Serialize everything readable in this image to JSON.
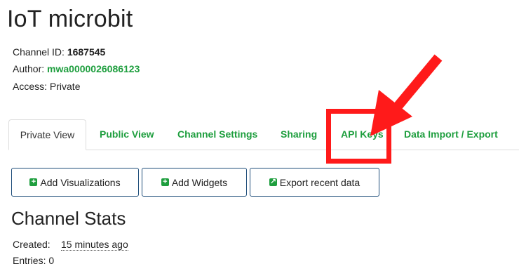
{
  "channel": {
    "title": "IoT microbit",
    "id_label": "Channel ID:",
    "id_value": "1687545",
    "author_label": "Author:",
    "author_value": "mwa0000026086123",
    "access_label": "Access:",
    "access_value": "Private"
  },
  "tabs": [
    {
      "label": "Private View",
      "active": true
    },
    {
      "label": "Public View"
    },
    {
      "label": "Channel Settings"
    },
    {
      "label": "Sharing"
    },
    {
      "label": "API Keys"
    },
    {
      "label": "Data Import / Export"
    }
  ],
  "buttons": {
    "add_visualizations": "Add Visualizations",
    "add_widgets": "Add Widgets",
    "export_recent_data": "Export recent data"
  },
  "stats": {
    "heading": "Channel Stats",
    "created_label": "Created:",
    "created_value": "15 minutes ago",
    "entries_label": "Entries:",
    "entries_value": "0"
  },
  "colors": {
    "link_green": "#1e9e3e",
    "button_border": "#1f4e7a",
    "annotation_red": "#ff1a1a"
  }
}
